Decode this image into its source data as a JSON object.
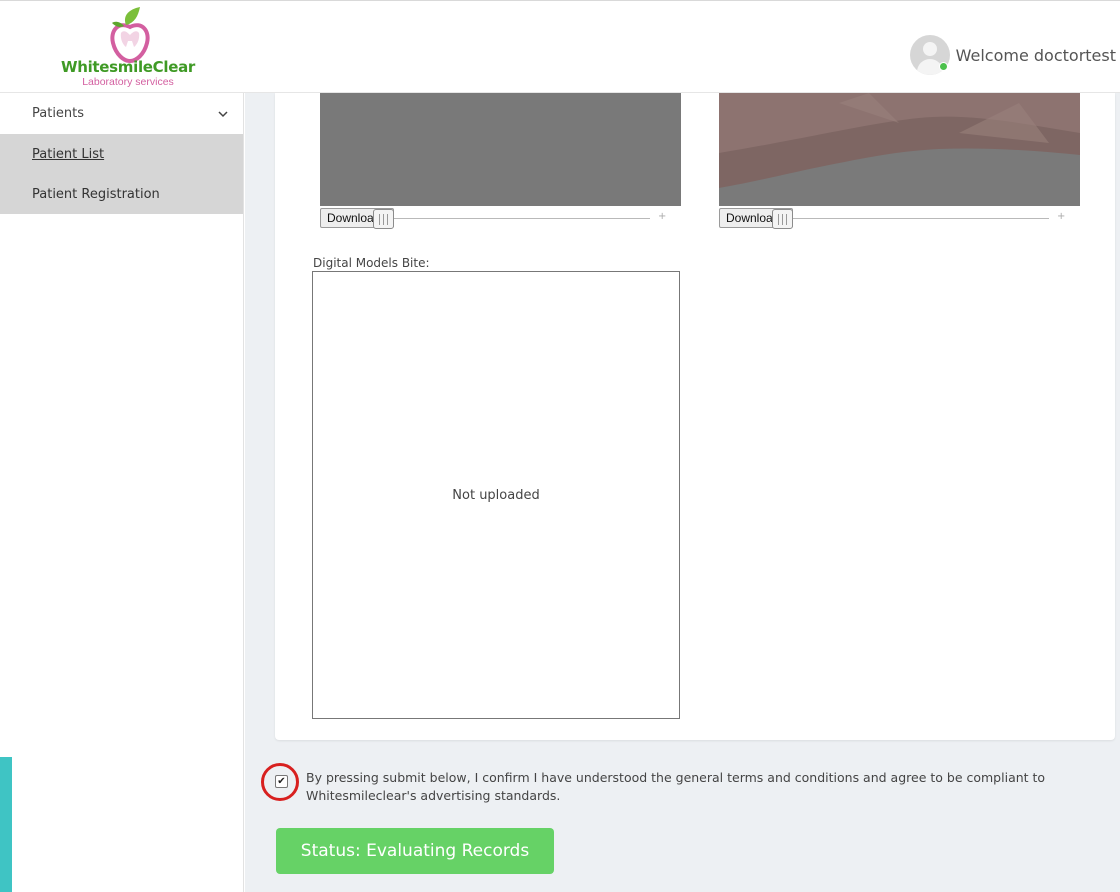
{
  "header": {
    "logo_title": "WhitesmileClear",
    "logo_subtitle": "Laboratory services",
    "welcome": "Welcome doctortest"
  },
  "sidebar": {
    "group_label": "Patients",
    "items": [
      {
        "label": "Patient List",
        "active": true
      },
      {
        "label": "Patient Registration",
        "active": false
      }
    ]
  },
  "media": {
    "players": [
      {
        "download_label": "Download"
      },
      {
        "download_label": "Download"
      }
    ],
    "digital_models_bite_label": "Digital Models Bite:",
    "bite_placeholder": "Not uploaded"
  },
  "terms": {
    "checked": true,
    "text": "By pressing submit below, I confirm I have understood the general terms and conditions and agree to be compliant to Whitesmileclear's advertising standards."
  },
  "status_button": "Status: Evaluating Records",
  "colors": {
    "status_green": "#66d266",
    "brand_green": "#3f9a25",
    "brand_pink": "#d35fa0",
    "accent_teal": "#3fc4c4",
    "highlight_red": "#d8201f"
  }
}
